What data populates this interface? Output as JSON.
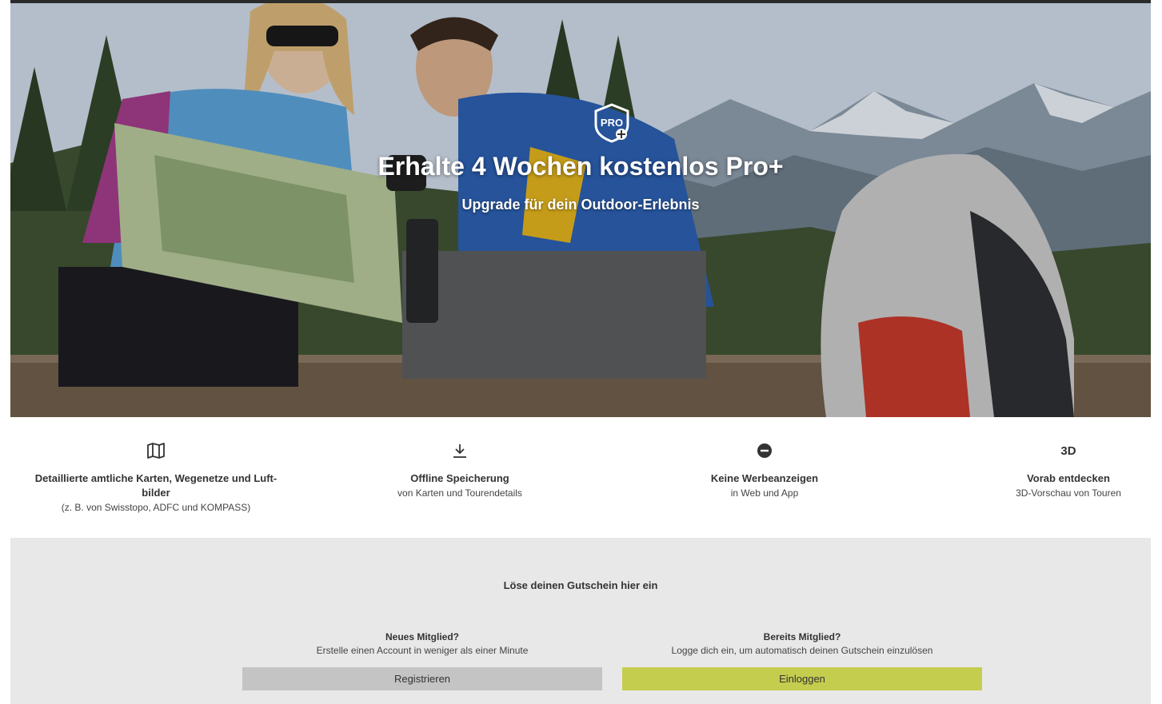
{
  "hero": {
    "badge_text": "PRO",
    "title": "Erhalte 4 Wochen kostenlos Pro+",
    "subtitle": "Upgrade für dein Outdoor-Erlebnis"
  },
  "features": [
    {
      "icon": "map-icon",
      "title": "Detaillierte amtliche Karten, Wegenetze und Luft-bilder",
      "desc": "(z. B. von Swisstopo, ADFC und KOMPASS)"
    },
    {
      "icon": "download-icon",
      "title": "Offline Speicherung",
      "desc": "von Karten und Tourendetails"
    },
    {
      "icon": "no-ads-icon",
      "title": "Keine Werbeanzeigen",
      "desc": "in Web und App"
    },
    {
      "icon": "3d-icon",
      "icon_text": "3D",
      "title": "Vorab entdecken",
      "desc": "3D-Vorschau von Touren"
    }
  ],
  "voucher": {
    "title": "Löse deinen Gutschein hier ein",
    "new_member": {
      "title": "Neues Mitglied?",
      "desc": "Erstelle einen Account in weniger als einer Minute",
      "button": "Registrieren"
    },
    "existing_member": {
      "title": "Bereits Mitglied?",
      "desc": "Logge dich ein, um automatisch deinen Gutschein einzulösen",
      "button": "Einloggen"
    }
  },
  "colors": {
    "login_button": "#c5cd4f",
    "register_button": "#c4c4c4",
    "voucher_background": "#e8e8e8"
  }
}
